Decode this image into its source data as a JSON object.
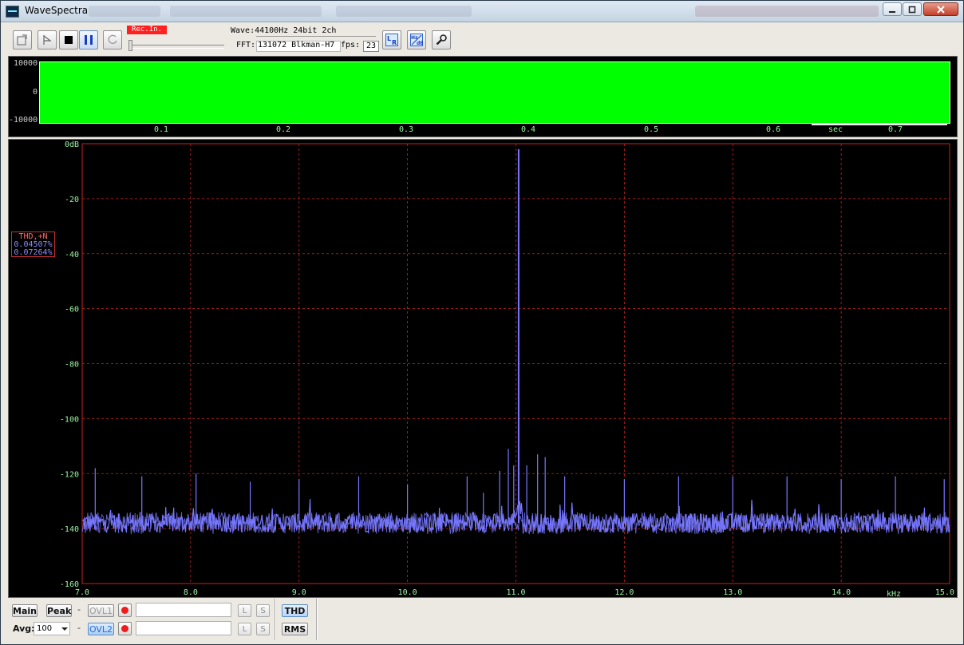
{
  "window": {
    "title": "WaveSpectra"
  },
  "toolbar": {
    "rec_indicator": "Rec.In.",
    "wave_info": "Wave:44100Hz 24bit 2ch",
    "fft_label": "FFT:",
    "fft_value": "131072 Blkman-H7",
    "fps_label": "fps:",
    "fps_value": "23"
  },
  "wave_panel": {
    "y_labels": [
      "10000",
      "0",
      "-10000"
    ],
    "x_labels": [
      "0.1",
      "0.2",
      "0.3",
      "0.4",
      "0.5",
      "0.6",
      "0.7"
    ],
    "x_unit": "sec"
  },
  "thd": {
    "label": "THD,+N",
    "value1": "0.04507%",
    "value2": "0.07264%"
  },
  "chart_data": {
    "type": "line",
    "title": "",
    "xlabel": "kHz",
    "ylabel": "",
    "x_tick_labels": [
      "7.0",
      "8.0",
      "9.0",
      "10.0",
      "11.0",
      "12.0",
      "13.0",
      "14.0",
      "15.0"
    ],
    "y_tick_labels": [
      "0dB",
      "-20",
      "-40",
      "-60",
      "-80",
      "-100",
      "-120",
      "-140",
      "-160"
    ],
    "xlim": [
      7.0,
      15.0
    ],
    "ylim": [
      -160,
      0
    ],
    "grid": true,
    "noise_floor": -138,
    "peaks": [
      {
        "x": 7.12,
        "y": -118
      },
      {
        "x": 7.55,
        "y": -121
      },
      {
        "x": 8.05,
        "y": -120
      },
      {
        "x": 8.55,
        "y": -123
      },
      {
        "x": 9.0,
        "y": -122
      },
      {
        "x": 9.55,
        "y": -121
      },
      {
        "x": 10.0,
        "y": -124
      },
      {
        "x": 10.55,
        "y": -121
      },
      {
        "x": 10.7,
        "y": -127
      },
      {
        "x": 10.85,
        "y": -119
      },
      {
        "x": 10.93,
        "y": -111
      },
      {
        "x": 10.98,
        "y": -117
      },
      {
        "x": 11.025,
        "y": -2
      },
      {
        "x": 11.1,
        "y": -117
      },
      {
        "x": 11.2,
        "y": -113
      },
      {
        "x": 11.27,
        "y": -114
      },
      {
        "x": 11.45,
        "y": -121
      },
      {
        "x": 12.0,
        "y": -122
      },
      {
        "x": 12.5,
        "y": -121
      },
      {
        "x": 13.0,
        "y": -121
      },
      {
        "x": 13.5,
        "y": -121
      },
      {
        "x": 14.0,
        "y": -122
      },
      {
        "x": 14.5,
        "y": -121
      },
      {
        "x": 14.95,
        "y": -122
      }
    ],
    "series_color": "#7777ff",
    "grid_color": "#d02020",
    "tick_color": "#9af2a0"
  },
  "bottombar": {
    "main_label": "Main",
    "peak_label": "Peak",
    "ovl1_label": "OVL1",
    "ovl2_label": "OVL2",
    "avg_label": "Avg:",
    "avg_value": "100",
    "l_label": "L",
    "s_label": "S",
    "thd_label": "THD",
    "rms_label": "RMS",
    "dash": "-"
  }
}
